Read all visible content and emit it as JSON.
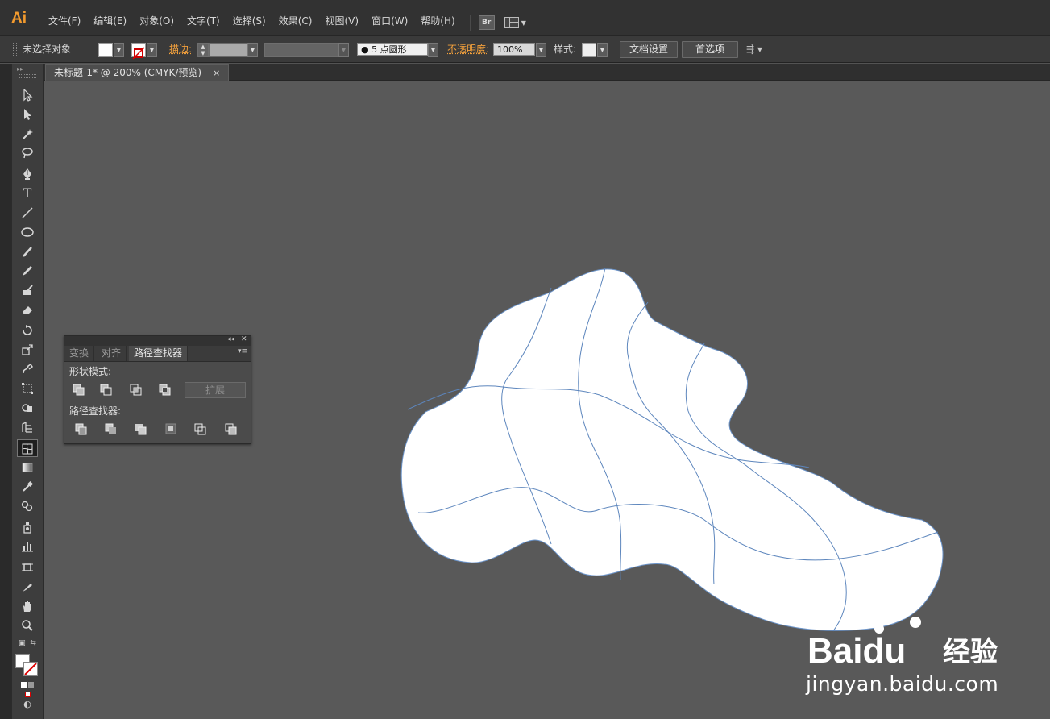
{
  "app": {
    "logo": "Ai",
    "menu": [
      "文件(F)",
      "编辑(E)",
      "对象(O)",
      "文字(T)",
      "选择(S)",
      "效果(C)",
      "视图(V)",
      "窗口(W)",
      "帮助(H)"
    ],
    "bridge_button": "Br"
  },
  "control_bar": {
    "selection_status": "未选择对象",
    "stroke_label": "描边",
    "brush_value": "5 点圆形",
    "opacity_label": "不透明度",
    "opacity_value": "100%",
    "style_label": "样式",
    "doc_setup_button": "文档设置",
    "preferences_button": "首选项"
  },
  "document": {
    "tab_title": "未标题-1* @ 200% (CMYK/预览)",
    "close_glyph": "×"
  },
  "pathfinder_panel": {
    "tabs": [
      "变换",
      "对齐",
      "路径查找器"
    ],
    "active_tab_index": 2,
    "shape_modes_label": "形状模式",
    "expand_button": "扩展",
    "pathfinders_label": "路径查找器"
  },
  "watermark": {
    "brand": "Baidu",
    "cn": "经验",
    "url": "jingyan.baidu.com"
  },
  "colors": {
    "accent_orange": "#f29a2e",
    "canvas_bg": "#595959",
    "shape_fill": "#ffffff",
    "mesh_stroke": "#4a7bb7"
  }
}
